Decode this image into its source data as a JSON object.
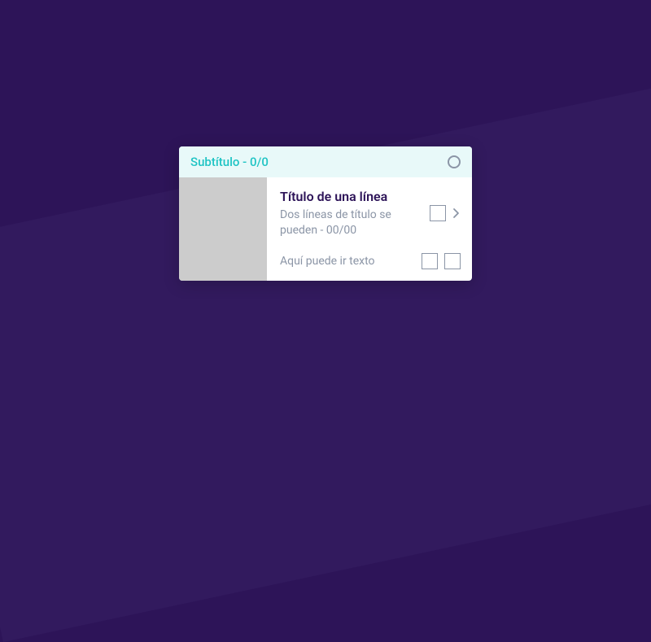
{
  "header": {
    "subtitle": "Subtítulo - 0/0"
  },
  "main": {
    "title": "Título de una línea",
    "description": "Dos líneas de título se pueden - 00/00"
  },
  "footer": {
    "text": "Aquí puede ir texto"
  }
}
